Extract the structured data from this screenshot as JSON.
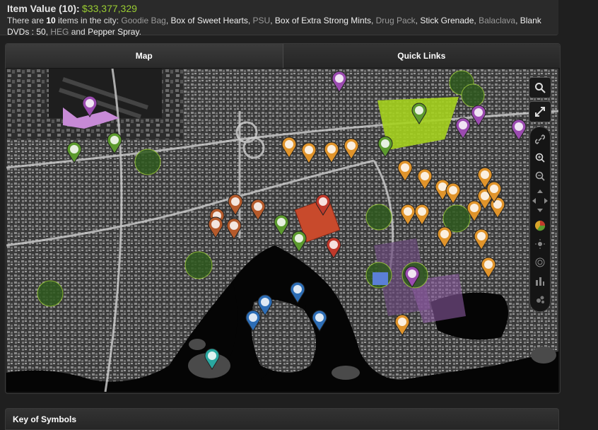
{
  "info": {
    "title_label": "Item Value (10):",
    "total_value": "$33,377,329",
    "line1_prefix": "There are ",
    "item_count": "10",
    "line1_middle": " items in the city: ",
    "items": [
      {
        "name": "Goodie Bag",
        "color": "gray"
      },
      {
        "name": "Box of Sweet Hearts",
        "color": "white"
      },
      {
        "name": "PSU",
        "color": "gray"
      },
      {
        "name": "Box of Extra Strong Mints",
        "color": "white"
      },
      {
        "name": "Drug Pack",
        "color": "gray"
      },
      {
        "name": "Stick Grenade",
        "color": "white"
      },
      {
        "name": "Balaclava",
        "color": "gray"
      },
      {
        "name": "Blank DVDs : 50",
        "color": "white"
      },
      {
        "name": "HEG",
        "color": "gray"
      },
      {
        "name": "Pepper Spray",
        "color": "white"
      }
    ]
  },
  "tabs": {
    "map": "Map",
    "quick_links": "Quick Links"
  },
  "key_title": "Key of Symbols",
  "colors": {
    "money": "#9acd32",
    "purple": "#9b4bb0",
    "orange": "#e0942b",
    "brown": "#b55a2b",
    "green": "#5c9a2e",
    "blue": "#2d6db5",
    "teal": "#2aa7a0",
    "red": "#c0392b"
  },
  "map_markers": [
    {
      "name": "airport-marker",
      "icon": "plane-icon",
      "color": "purple"
    },
    {
      "name": "target-marker",
      "icon": "target-icon",
      "color": "purple"
    },
    {
      "name": "purple-top-marker",
      "icon": "swirl-icon",
      "color": "purple"
    },
    {
      "name": "pin-right-marker",
      "icon": "pin-icon",
      "color": "purple"
    },
    {
      "name": "car-marker",
      "icon": "car-icon",
      "color": "purple"
    },
    {
      "name": "park-marker",
      "icon": "tree-icon",
      "color": "green"
    },
    {
      "name": "grad-marker",
      "icon": "cap-icon",
      "color": "green"
    },
    {
      "name": "gym-marker",
      "icon": "dumbbell-icon",
      "color": "green"
    },
    {
      "name": "stadium-marker",
      "icon": "horseshoe-icon",
      "color": "green"
    },
    {
      "name": "info-marker",
      "icon": "info-icon",
      "color": "brown"
    },
    {
      "name": "hospital-marker",
      "icon": "cross-icon",
      "color": "red"
    },
    {
      "name": "jail-marker",
      "icon": "grid-icon",
      "color": "red"
    },
    {
      "name": "museum-marker",
      "icon": "pillars-icon",
      "color": "blue"
    },
    {
      "name": "star-marker",
      "icon": "star-icon",
      "color": "blue"
    },
    {
      "name": "key-marker",
      "icon": "key-icon",
      "color": "teal"
    },
    {
      "name": "casino-marker",
      "icon": "dice-icon",
      "color": "orange"
    }
  ]
}
